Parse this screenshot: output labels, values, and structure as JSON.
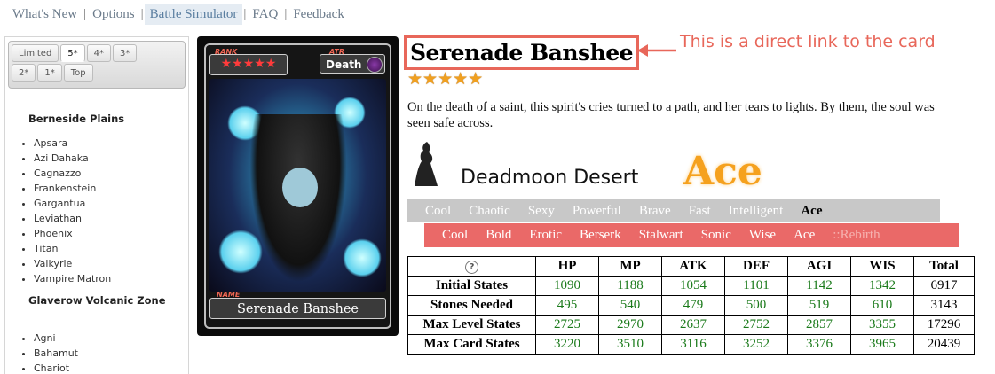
{
  "nav": {
    "items": [
      "What's New",
      "Options",
      "Battle Simulator",
      "FAQ",
      "Feedback"
    ],
    "active_index": 2
  },
  "sidebar": {
    "tabs_row1": [
      "Limited",
      "5*",
      "4*",
      "3*"
    ],
    "tabs_row2": [
      "2*",
      "1*",
      "Top"
    ],
    "selected_tab": "5*",
    "regions": [
      {
        "name": "Berneside Plains",
        "items": [
          "Apsara",
          "Azi Dahaka",
          "Cagnazzo",
          "Frankenstein",
          "Gargantua",
          "Leviathan",
          "Phoenix",
          "Titan",
          "Valkyrie",
          "Vampire Matron"
        ]
      },
      {
        "name": "Glaverow Volcanic Zone",
        "items": [
          "Agni",
          "Bahamut",
          "Chariot"
        ]
      }
    ]
  },
  "card": {
    "rank_label": "RANK",
    "rank_stars": "★★★★★",
    "atr_label": "ATR",
    "attribute": "Death",
    "name_label": "NAME",
    "name": "Serenade Banshee"
  },
  "detail": {
    "title": "Serenade Banshee",
    "annotation": "This is a direct link to the card",
    "stars": "★★★★★",
    "description": "On the death of a saint, this spirit's cries turned to a path, and her tears to lights. By them, the soul was seen safe across.",
    "area": "Deadmoon Desert",
    "rank": "Ace",
    "accent_color": "#e8675a",
    "evolution_row1": [
      "Cool",
      "Chaotic",
      "Sexy",
      "Powerful",
      "Brave",
      "Fast",
      "Intelligent",
      "Ace"
    ],
    "evolution_row1_current": "Ace",
    "evolution_row2": [
      "Cool",
      "Bold",
      "Erotic",
      "Berserk",
      "Stalwart",
      "Sonic",
      "Wise",
      "Ace",
      "::Rebirth"
    ]
  },
  "stats": {
    "headers": [
      "HP",
      "MP",
      "ATK",
      "DEF",
      "AGI",
      "WIS",
      "Total"
    ],
    "rows": [
      {
        "label": "Initial States",
        "values": [
          "1090",
          "1188",
          "1054",
          "1101",
          "1142",
          "1342",
          "6917"
        ]
      },
      {
        "label": "Stones Needed",
        "values": [
          "495",
          "540",
          "479",
          "500",
          "519",
          "610",
          "3143"
        ]
      },
      {
        "label": "Max Level States",
        "values": [
          "2725",
          "2970",
          "2637",
          "2752",
          "2857",
          "3355",
          "17296"
        ]
      },
      {
        "label": "Max Card States",
        "values": [
          "3220",
          "3510",
          "3116",
          "3252",
          "3376",
          "3965",
          "20439"
        ]
      }
    ]
  }
}
